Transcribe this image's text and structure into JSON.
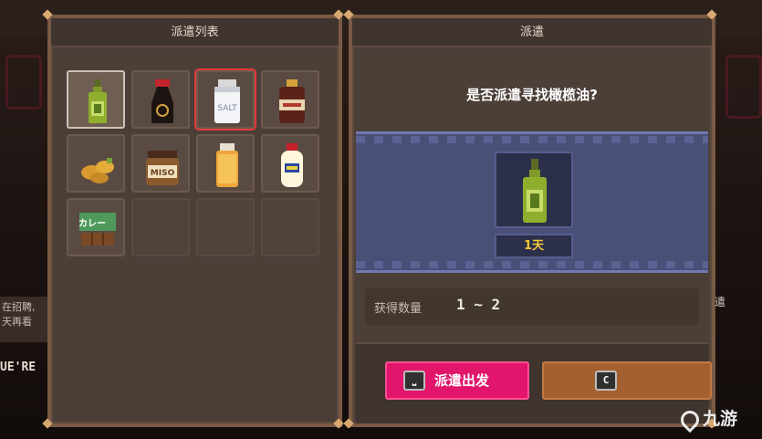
{
  "left_panel": {
    "title": "派遣列表"
  },
  "right_panel": {
    "title": "派遣",
    "question": "是否派遣寻找橄榄油?",
    "duration": "1天",
    "quantity_label": "获得数量",
    "quantity_value": "1 ~ 2",
    "dispatch_button": "派遣出发",
    "dispatch_key": "⎵",
    "cancel_key": "C"
  },
  "items": [
    {
      "name": "olive-oil-bottle-icon",
      "selected": true
    },
    {
      "name": "soy-sauce-bottle-icon"
    },
    {
      "name": "salt-shaker-icon",
      "label": "SALT",
      "highlighted": true
    },
    {
      "name": "sauce-jar-icon"
    },
    {
      "name": "ginger-icon"
    },
    {
      "name": "miso-jar-icon",
      "label": "MISO"
    },
    {
      "name": "spice-jar-icon"
    },
    {
      "name": "mayonnaise-icon"
    },
    {
      "name": "curry-block-icon",
      "label": "カレー"
    }
  ],
  "background": {
    "left_text": "在招聘,\n天再看",
    "left_sign": "UE'RE",
    "right_text": "遣"
  },
  "watermark": "九游",
  "colors": {
    "dispatch_button": "#e0156b",
    "cancel_button": "#a5602f",
    "duration_text": "#f3c63a",
    "highlight": "#e33a3a"
  }
}
